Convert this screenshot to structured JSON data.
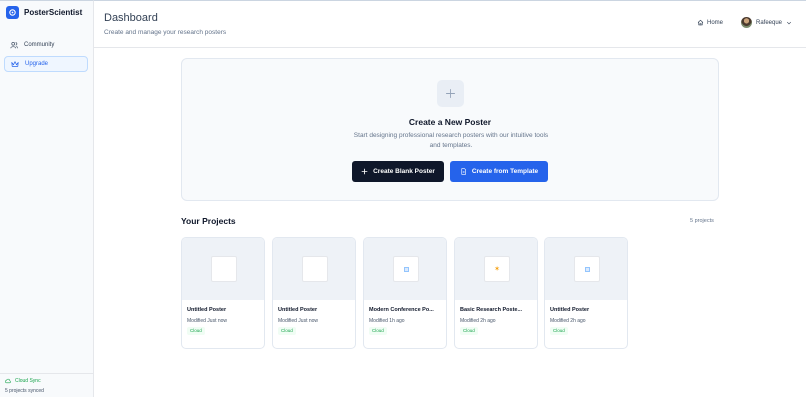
{
  "brand": {
    "name": "PosterScientist"
  },
  "sidebar": {
    "items": [
      {
        "label": "Community",
        "icon": "users-icon"
      },
      {
        "label": "Upgrade",
        "icon": "crown-icon"
      }
    ],
    "footer": {
      "sync_label": "Cloud Sync",
      "sync_sub": "5 projects synced"
    }
  },
  "header": {
    "title": "Dashboard",
    "subtitle": "Create and manage your research posters",
    "home_label": "Home",
    "user_name": "Rafeeque"
  },
  "create": {
    "title": "Create a New Poster",
    "description": "Start designing professional research posters with our intuitive tools and templates.",
    "blank_label": "Create Blank Poster",
    "template_label": "Create from Template"
  },
  "projects": {
    "title": "Your Projects",
    "count": "5 projects",
    "items": [
      {
        "name": "Untitled Poster",
        "modified": "Modified Just now",
        "status": "Cloud",
        "thumb": "blank"
      },
      {
        "name": "Untitled Poster",
        "modified": "Modified Just now",
        "status": "Cloud",
        "thumb": "blank"
      },
      {
        "name": "Modern Conference Po...",
        "modified": "Modified 1h ago",
        "status": "Cloud",
        "thumb": "blue"
      },
      {
        "name": "Basic Research Poste...",
        "modified": "Modified 2h ago",
        "status": "Cloud",
        "thumb": "yellow"
      },
      {
        "name": "Untitled Poster",
        "modified": "Modified 2h ago",
        "status": "Cloud",
        "thumb": "blue"
      }
    ]
  },
  "colors": {
    "accent": "#2563eb",
    "dark": "#0f172a",
    "success": "#16a34a"
  }
}
